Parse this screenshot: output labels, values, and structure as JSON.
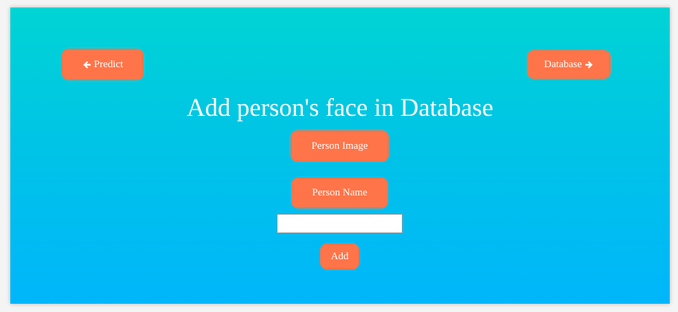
{
  "nav": {
    "predict_label": "Predict",
    "predict_icon": "arrow-left-icon",
    "database_label": "Database",
    "database_icon": "arrow-right-icon"
  },
  "page": {
    "title": "Add person's face in Database"
  },
  "form": {
    "image_button_label": "Person Image",
    "name_button_label": "Person Name",
    "name_input_value": "",
    "name_input_placeholder": "",
    "add_button_label": "Add"
  },
  "colors": {
    "button_bg": "#ff7448",
    "gradient_top": "#00d4d4",
    "gradient_bottom": "#00b6fb",
    "text": "#ffffff"
  }
}
